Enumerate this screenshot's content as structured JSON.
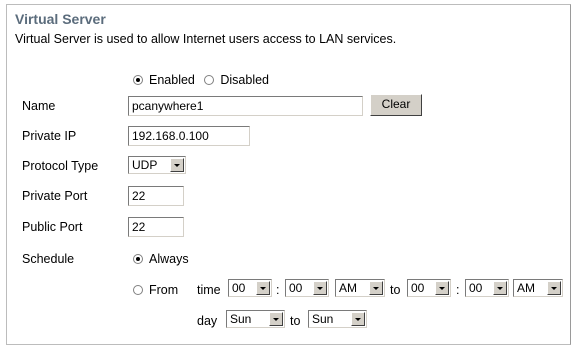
{
  "section": {
    "title": "Virtual Server",
    "description": "Virtual Server is used to allow Internet users access to LAN services."
  },
  "status": {
    "enabled_label": "Enabled",
    "disabled_label": "Disabled",
    "selected": "Enabled"
  },
  "name": {
    "label": "Name",
    "value": "pcanywhere1",
    "clear_label": "Clear"
  },
  "private_ip": {
    "label": "Private IP",
    "value": "192.168.0.100"
  },
  "protocol": {
    "label": "Protocol Type",
    "value": "UDP"
  },
  "private_port": {
    "label": "Private Port",
    "value": "22"
  },
  "public_port": {
    "label": "Public Port",
    "value": "22"
  },
  "schedule": {
    "label": "Schedule",
    "always_label": "Always",
    "from_label": "From",
    "time_label": "time",
    "colon": ":",
    "to_label": "to",
    "day_label": "day",
    "selected": "Always",
    "from_hour": "00",
    "from_minute": "00",
    "from_ampm": "AM",
    "to_hour": "00",
    "to_minute": "00",
    "to_ampm": "AM",
    "from_day": "Sun",
    "to_day": "Sun"
  },
  "colors": {
    "title": "#5b6c7c",
    "button_face": "#d4d0c8"
  }
}
